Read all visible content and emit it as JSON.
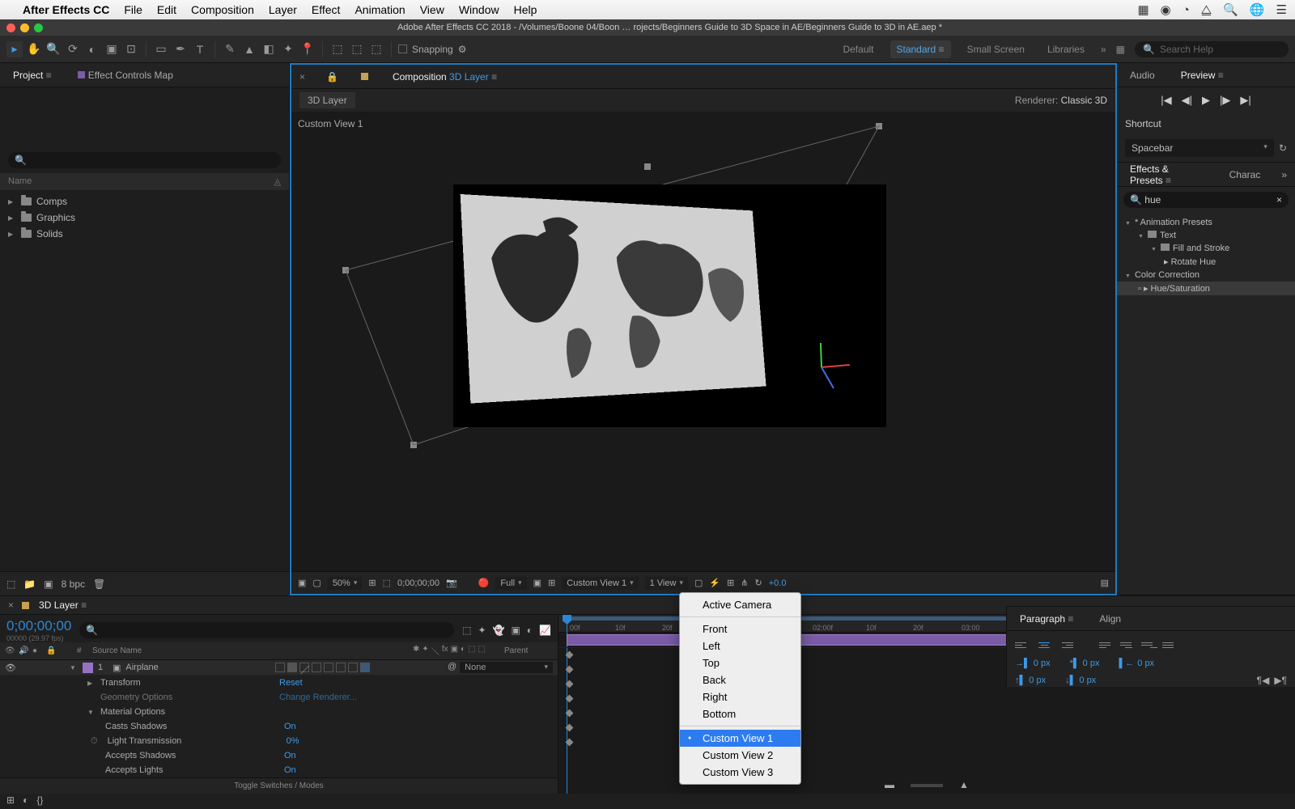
{
  "mac_menu": {
    "app": "After Effects CC",
    "items": [
      "File",
      "Edit",
      "Composition",
      "Layer",
      "Effect",
      "Animation",
      "View",
      "Window",
      "Help"
    ]
  },
  "window_title": "Adobe After Effects CC 2018 - /Volumes/Boone 04/Boon … rojects/Beginners Guide to 3D Space in AE/Beginners Guide to 3D in AE.aep *",
  "toolbar": {
    "snapping": "Snapping",
    "workspaces": [
      "Default",
      "Standard",
      "Small Screen",
      "Libraries"
    ],
    "active_workspace": "Standard",
    "search_placeholder": "Search Help"
  },
  "left_panel": {
    "tabs": {
      "project": "Project",
      "effect_controls": "Effect Controls Map"
    },
    "search_placeholder": "",
    "columns_header": "Name",
    "items": [
      "Comps",
      "Graphics",
      "Solids"
    ],
    "footer_bpc": "8 bpc"
  },
  "comp": {
    "header_prefix": "Composition",
    "header_name": "3D Layer",
    "tab": "3D Layer",
    "renderer_label": "Renderer:",
    "renderer_value": "Classic 3D",
    "view_label": "Custom View 1",
    "toolbar": {
      "zoom": "50%",
      "timecode": "0;00;00;00",
      "resolution": "Full",
      "view_select": "Custom View 1",
      "view_count": "1 View",
      "exposure": "+0.0"
    }
  },
  "view_menu": {
    "items": [
      "Active Camera",
      "Front",
      "Left",
      "Top",
      "Back",
      "Right",
      "Bottom",
      "Custom View 1",
      "Custom View 2",
      "Custom View 3"
    ],
    "selected": "Custom View 1"
  },
  "right_panel": {
    "audio_tab": "Audio",
    "preview_tab": "Preview",
    "shortcut_label": "Shortcut",
    "shortcut_value": "Spacebar",
    "effects_tab": "Effects & Presets",
    "charac_tab": "Charac",
    "effects_search": "hue",
    "effects_tree": {
      "presets": "* Animation Presets",
      "text": "Text",
      "fillstroke": "Fill and Stroke",
      "rotatehue": "Rotate Hue",
      "colorcorr": "Color Correction",
      "huesat": "Hue/Saturation"
    }
  },
  "timeline": {
    "tab": "3D Layer",
    "timecode": "0;00;00;00",
    "fps": "00000 (29.97 fps)",
    "columns": {
      "source": "Source Name",
      "parent": "Parent"
    },
    "layer": {
      "num": "1",
      "name": "Airplane",
      "parent": "None"
    },
    "props": [
      {
        "label": "Transform",
        "value": "Reset"
      },
      {
        "label": "Geometry Options",
        "value": "Change Renderer..."
      },
      {
        "label": "Material Options",
        "value": ""
      },
      {
        "label": "Casts Shadows",
        "value": "On"
      },
      {
        "label": "Light Transmission",
        "value": "0%"
      },
      {
        "label": "Accepts Shadows",
        "value": "On"
      },
      {
        "label": "Accepts Lights",
        "value": "On"
      }
    ],
    "ruler": [
      "00f",
      "10f",
      "20f",
      "02:00f",
      "10f",
      "20f",
      "03:00"
    ],
    "footer": "Toggle Switches / Modes"
  },
  "para_panel": {
    "paragraph": "Paragraph",
    "align": "Align",
    "indent_val": "0 px"
  }
}
